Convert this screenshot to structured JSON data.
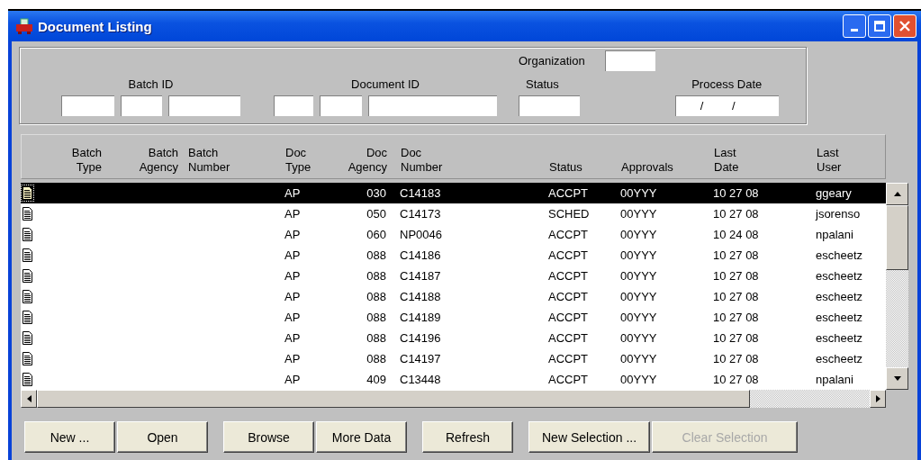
{
  "window": {
    "title": "Document Listing"
  },
  "filters": {
    "batch_id": {
      "label": "Batch ID"
    },
    "document_id": {
      "label": "Document ID"
    },
    "organization": {
      "label": "Organization"
    },
    "status": {
      "label": "Status"
    },
    "process_date": {
      "label": "Process Date",
      "value": "/ /"
    }
  },
  "table": {
    "columns": [
      "Batch\nType",
      "Batch\nAgency",
      "Batch\nNumber",
      "Doc\nType",
      "Doc\nAgency",
      "Doc\nNumber",
      "Status",
      "Approvals",
      "Last\nDate",
      "Last\nUser"
    ],
    "rows": [
      {
        "selected": true,
        "doc_type": "AP",
        "doc_agency": "030",
        "doc_number": "C14183",
        "status": "ACCPT",
        "approvals": "00YYY",
        "last_date": "10 27 08",
        "last_user": "ggeary"
      },
      {
        "selected": false,
        "doc_type": "AP",
        "doc_agency": "050",
        "doc_number": "C14173",
        "status": "SCHED",
        "approvals": "00YYY",
        "last_date": "10 27 08",
        "last_user": "jsorenso"
      },
      {
        "selected": false,
        "doc_type": "AP",
        "doc_agency": "060",
        "doc_number": "NP0046",
        "status": "ACCPT",
        "approvals": "00YYY",
        "last_date": "10 24 08",
        "last_user": "npalani"
      },
      {
        "selected": false,
        "doc_type": "AP",
        "doc_agency": "088",
        "doc_number": "C14186",
        "status": "ACCPT",
        "approvals": "00YYY",
        "last_date": "10 27 08",
        "last_user": "escheetz"
      },
      {
        "selected": false,
        "doc_type": "AP",
        "doc_agency": "088",
        "doc_number": "C14187",
        "status": "ACCPT",
        "approvals": "00YYY",
        "last_date": "10 27 08",
        "last_user": "escheetz"
      },
      {
        "selected": false,
        "doc_type": "AP",
        "doc_agency": "088",
        "doc_number": "C14188",
        "status": "ACCPT",
        "approvals": "00YYY",
        "last_date": "10 27 08",
        "last_user": "escheetz"
      },
      {
        "selected": false,
        "doc_type": "AP",
        "doc_agency": "088",
        "doc_number": "C14189",
        "status": "ACCPT",
        "approvals": "00YYY",
        "last_date": "10 27 08",
        "last_user": "escheetz"
      },
      {
        "selected": false,
        "doc_type": "AP",
        "doc_agency": "088",
        "doc_number": "C14196",
        "status": "ACCPT",
        "approvals": "00YYY",
        "last_date": "10 27 08",
        "last_user": "escheetz"
      },
      {
        "selected": false,
        "doc_type": "AP",
        "doc_agency": "088",
        "doc_number": "C14197",
        "status": "ACCPT",
        "approvals": "00YYY",
        "last_date": "10 27 08",
        "last_user": "escheetz"
      },
      {
        "selected": false,
        "doc_type": "AP",
        "doc_agency": "409",
        "doc_number": "C13448",
        "status": "ACCPT",
        "approvals": "00YYY",
        "last_date": "10 27 08",
        "last_user": "npalani"
      }
    ]
  },
  "button_groups": [
    [
      {
        "label": "New ...",
        "disabled": false
      },
      {
        "label": "Open",
        "disabled": false
      }
    ],
    [
      {
        "label": "Browse",
        "disabled": false
      },
      {
        "label": "More Data",
        "disabled": false
      }
    ],
    [
      {
        "label": "Refresh",
        "disabled": false
      }
    ],
    [
      {
        "label": "New Selection ...",
        "disabled": false
      },
      {
        "label": "Clear Selection",
        "disabled": true
      }
    ]
  ]
}
